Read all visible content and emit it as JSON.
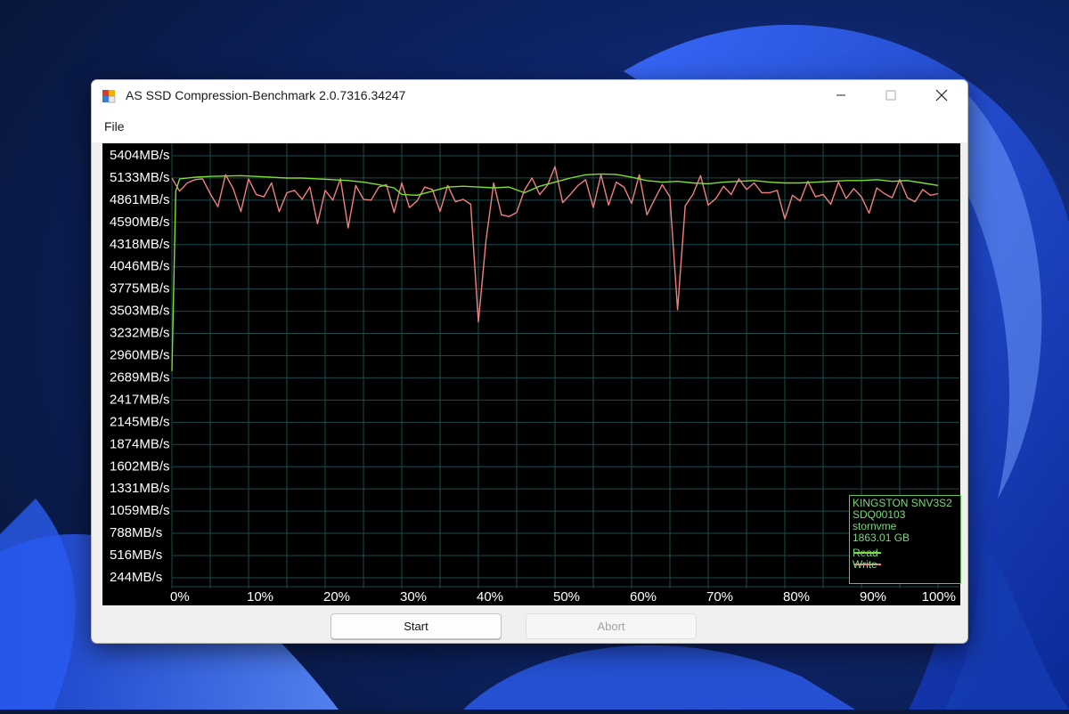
{
  "window": {
    "title": "AS SSD Compression-Benchmark 2.0.7316.34247",
    "menu": [
      "File"
    ],
    "controls": [
      "minimize-icon",
      "maximize-icon",
      "close-icon"
    ]
  },
  "buttons": {
    "start_label": "Start",
    "abort_label": "Abort"
  },
  "legend": {
    "drive_model": "KINGSTON SNV3S2",
    "firmware": "SDQ00103",
    "driver": "stornvme",
    "capacity": "1863.01 GB",
    "read_label": "Read",
    "write_label": "Write"
  },
  "colors": {
    "read": "#7ee02e",
    "write": "#f08080",
    "grid": "#1f4a4a",
    "chart_bg": "#000000",
    "axis_text": "#ffffff"
  },
  "chart_data": {
    "type": "line",
    "title": "",
    "xlabel": "",
    "ylabel": "",
    "y_tick_labels": [
      "5404MB/s",
      "5133MB/s",
      "4861MB/s",
      "4590MB/s",
      "4318MB/s",
      "4046MB/s",
      "3775MB/s",
      "3503MB/s",
      "3232MB/s",
      "2960MB/s",
      "2689MB/s",
      "2417MB/s",
      "2145MB/s",
      "1874MB/s",
      "1602MB/s",
      "1331MB/s",
      "1059MB/s",
      "788MB/s",
      "516MB/s",
      "244MB/s"
    ],
    "y_ticks": [
      5404,
      5133,
      4861,
      4590,
      4318,
      4046,
      3775,
      3503,
      3232,
      2960,
      2689,
      2417,
      2145,
      1874,
      1602,
      1331,
      1059,
      788,
      516,
      244
    ],
    "x_tick_labels": [
      "0%",
      "10%",
      "20%",
      "30%",
      "40%",
      "50%",
      "60%",
      "70%",
      "80%",
      "90%",
      "100%"
    ],
    "x_ticks": [
      0,
      10,
      20,
      30,
      40,
      50,
      60,
      70,
      80,
      90,
      100
    ],
    "xlim": [
      0,
      100
    ],
    "ylim": [
      244,
      5404
    ],
    "grid": true,
    "legend_position": "bottom-right",
    "series": [
      {
        "name": "Read",
        "x": [
          0,
          0.5,
          1,
          3,
          5,
          7,
          9,
          11,
          13,
          15,
          17,
          19,
          21,
          23,
          25,
          27,
          29,
          30,
          32,
          34,
          36,
          38,
          40,
          42,
          44,
          46,
          48,
          50,
          52,
          54,
          56,
          58,
          60,
          62,
          64,
          66,
          68,
          70,
          72,
          74,
          76,
          78,
          80,
          82,
          84,
          86,
          88,
          90,
          92,
          94,
          96,
          98,
          100
        ],
        "values": [
          2750,
          4950,
          5100,
          5120,
          5130,
          5135,
          5140,
          5130,
          5120,
          5110,
          5110,
          5100,
          5090,
          5080,
          5060,
          5030,
          4990,
          4910,
          4900,
          4950,
          5000,
          5010,
          5000,
          4990,
          5000,
          4930,
          5010,
          5060,
          5110,
          5150,
          5160,
          5155,
          5120,
          5080,
          5060,
          5070,
          5050,
          5040,
          5060,
          5070,
          5080,
          5060,
          5050,
          5050,
          5060,
          5070,
          5080,
          5080,
          5090,
          5070,
          5080,
          5050,
          5020
        ]
      },
      {
        "name": "Write",
        "x": [
          0,
          1,
          2,
          3,
          4,
          5,
          6,
          7,
          8,
          9,
          10,
          11,
          12,
          13,
          14,
          15,
          16,
          17,
          18,
          19,
          20,
          21,
          22,
          23,
          24,
          25,
          26,
          27,
          28,
          29,
          30,
          31,
          32,
          33,
          34,
          35,
          36,
          37,
          38,
          39,
          40,
          41,
          42,
          43,
          44,
          45,
          46,
          47,
          48,
          49,
          50,
          51,
          52,
          53,
          54,
          55,
          56,
          57,
          58,
          59,
          60,
          61,
          62,
          63,
          64,
          65,
          66,
          67,
          68,
          69,
          70,
          71,
          72,
          73,
          74,
          75,
          76,
          77,
          78,
          79,
          80,
          81,
          82,
          83,
          84,
          85,
          86,
          87,
          88,
          89,
          90,
          91,
          92,
          93,
          94,
          95,
          96,
          97,
          98,
          99,
          100
        ],
        "values": [
          5110,
          4950,
          5050,
          5090,
          5100,
          4920,
          4760,
          5150,
          4980,
          4700,
          5100,
          4910,
          4880,
          5050,
          4700,
          4930,
          4960,
          4850,
          5000,
          4550,
          4960,
          4840,
          5100,
          4500,
          5020,
          4850,
          4840,
          5000,
          5030,
          4690,
          5050,
          4750,
          4830,
          5000,
          4970,
          4700,
          5020,
          4820,
          4850,
          4790,
          3350,
          4350,
          5050,
          4660,
          4640,
          4690,
          4960,
          5110,
          4910,
          5020,
          5250,
          4810,
          4910,
          5020,
          5090,
          4750,
          5150,
          4780,
          5060,
          5000,
          4800,
          5150,
          4660,
          4850,
          5030,
          4880,
          3500,
          4770,
          4910,
          5140,
          4780,
          4860,
          5010,
          4910,
          5100,
          4970,
          5050,
          4930,
          4930,
          4960,
          4610,
          4900,
          4830,
          5070,
          4880,
          4910,
          4790,
          5060,
          4860,
          4980,
          4880,
          4680,
          4990,
          4920,
          4870,
          5090,
          4870,
          4820,
          4970,
          4900,
          4920
        ]
      }
    ]
  }
}
